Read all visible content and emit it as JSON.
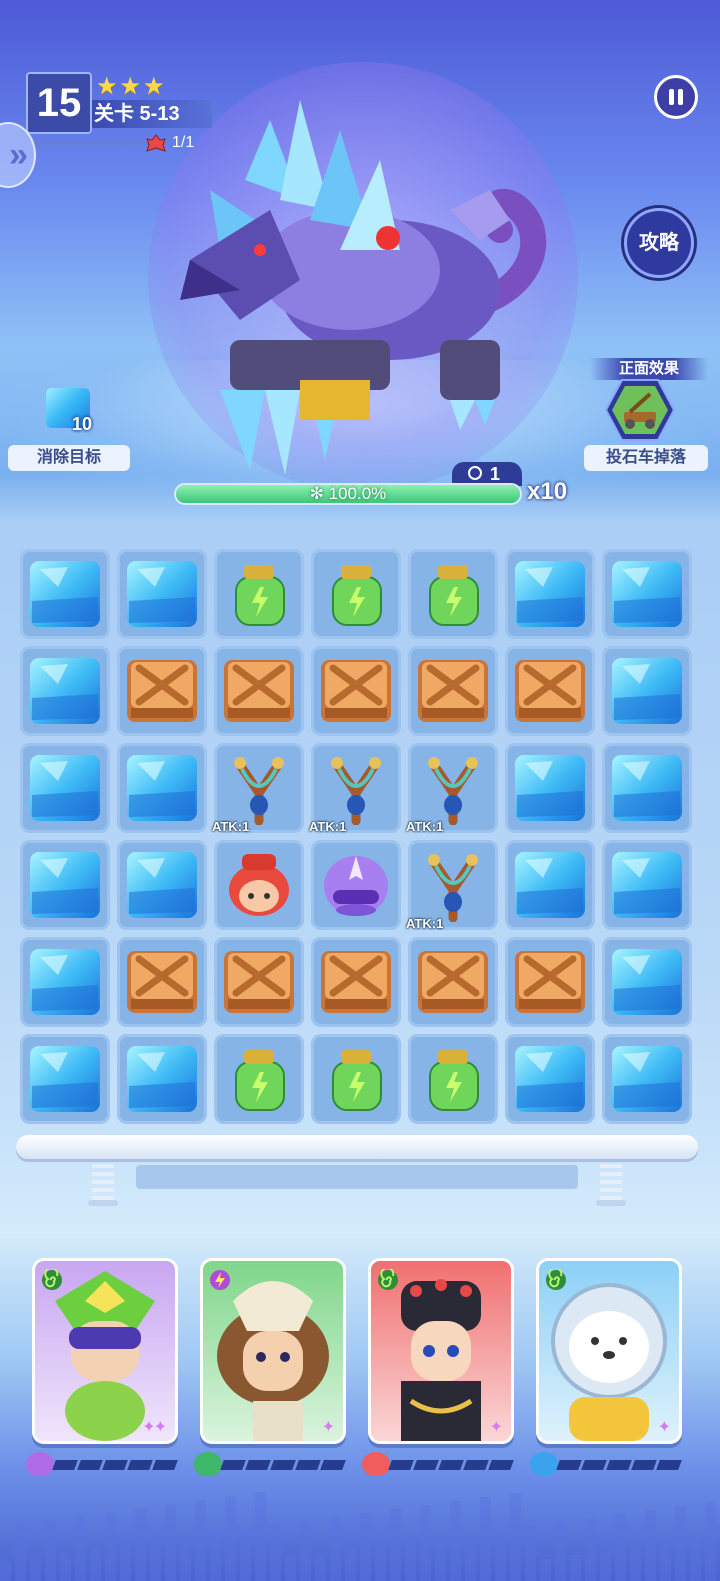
{
  "header": {
    "level": "15",
    "stars": "★★★",
    "stage": "关卡 5-13",
    "count": "1/1",
    "side_arrow": "»",
    "guide": "攻略"
  },
  "target": {
    "count": "10",
    "label": "消除目标"
  },
  "effect": {
    "title": "正面效果",
    "label": "投石车掉落"
  },
  "boss": {
    "timer": "1",
    "hp_percent_text": "100.0%",
    "hp_fraction": 1.0,
    "multiplier": "x10"
  },
  "board": {
    "rows": [
      [
        "ice",
        "ice",
        "jar",
        "jar",
        "jar",
        "ice",
        "ice"
      ],
      [
        "ice",
        "crate",
        "crate",
        "crate",
        "crate",
        "crate",
        "ice"
      ],
      [
        "ice",
        "ice",
        "slingshot",
        "slingshot",
        "slingshot",
        "ice",
        "ice"
      ],
      [
        "ice",
        "ice",
        "red-mask",
        "purple-mask",
        "slingshot",
        "ice",
        "ice"
      ],
      [
        "ice",
        "crate",
        "crate",
        "crate",
        "crate",
        "crate",
        "ice"
      ],
      [
        "ice",
        "ice",
        "jar",
        "jar",
        "jar",
        "ice",
        "ice"
      ]
    ],
    "atk_label": "ATK:1"
  },
  "heroes": [
    {
      "name": "green-ninja",
      "bg": "#c9a6f2",
      "pips": "✦✦",
      "badge": "spiral",
      "energy_color": "#b06be8"
    },
    {
      "name": "dino-girl",
      "bg": "#7fd68a",
      "pips": "✦",
      "badge": "lightning",
      "energy_color": "#3fb86a"
    },
    {
      "name": "opera-hero",
      "bg": "#f07070",
      "pips": "✦",
      "badge": "spiral",
      "energy_color": "#f05d5d"
    },
    {
      "name": "astro-bear",
      "bg": "#8dd0f7",
      "pips": "✦",
      "badge": "spiral",
      "energy_color": "#3aa3ee"
    }
  ],
  "colors": {
    "ice_light": "#9ef0ff",
    "ice_dark": "#1f7ee0",
    "crate": "#e39450",
    "jar_green": "#5fd15c",
    "hp_green": "#3bc77a"
  }
}
